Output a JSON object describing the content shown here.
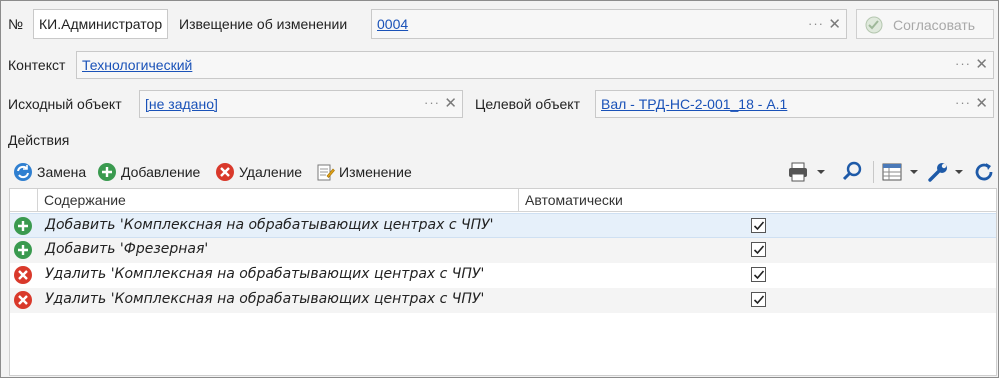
{
  "header": {
    "number_label": "№",
    "number_value": "КИ.Администратор",
    "notice_label": "Извещение об изменении",
    "notice_value": "0004",
    "approve_button": "Согласовать"
  },
  "context": {
    "label": "Контекст",
    "value": "Технологический"
  },
  "objects": {
    "source_label": "Исходный объект",
    "source_value": "[не задано]",
    "target_label": "Целевой объект",
    "target_value": "Вал - ТРД-НС-2-001_18 - А.1"
  },
  "actions": {
    "section_label": "Действия",
    "toolbar": {
      "replace": "Замена",
      "add": "Добавление",
      "delete": "Удаление",
      "modify": "Изменение"
    },
    "columns": [
      "Содержание",
      "Автоматически"
    ],
    "rows": [
      {
        "type": "add",
        "text": "Добавить 'Комплексная на обрабатывающих центрах с ЧПУ'",
        "auto": true
      },
      {
        "type": "add",
        "text": "Добавить 'Фрезерная'",
        "auto": true
      },
      {
        "type": "delete",
        "text": "Удалить 'Комплексная на обрабатывающих центрах с ЧПУ'",
        "auto": true
      },
      {
        "type": "delete",
        "text": "Удалить 'Комплексная на обрабатывающих центрах с ЧПУ'",
        "auto": true
      }
    ]
  },
  "colors": {
    "link": "#1a52b8",
    "add_green": "#3a9a4f",
    "delete_red": "#d9392b",
    "selected_row": "#e6f0fa"
  }
}
